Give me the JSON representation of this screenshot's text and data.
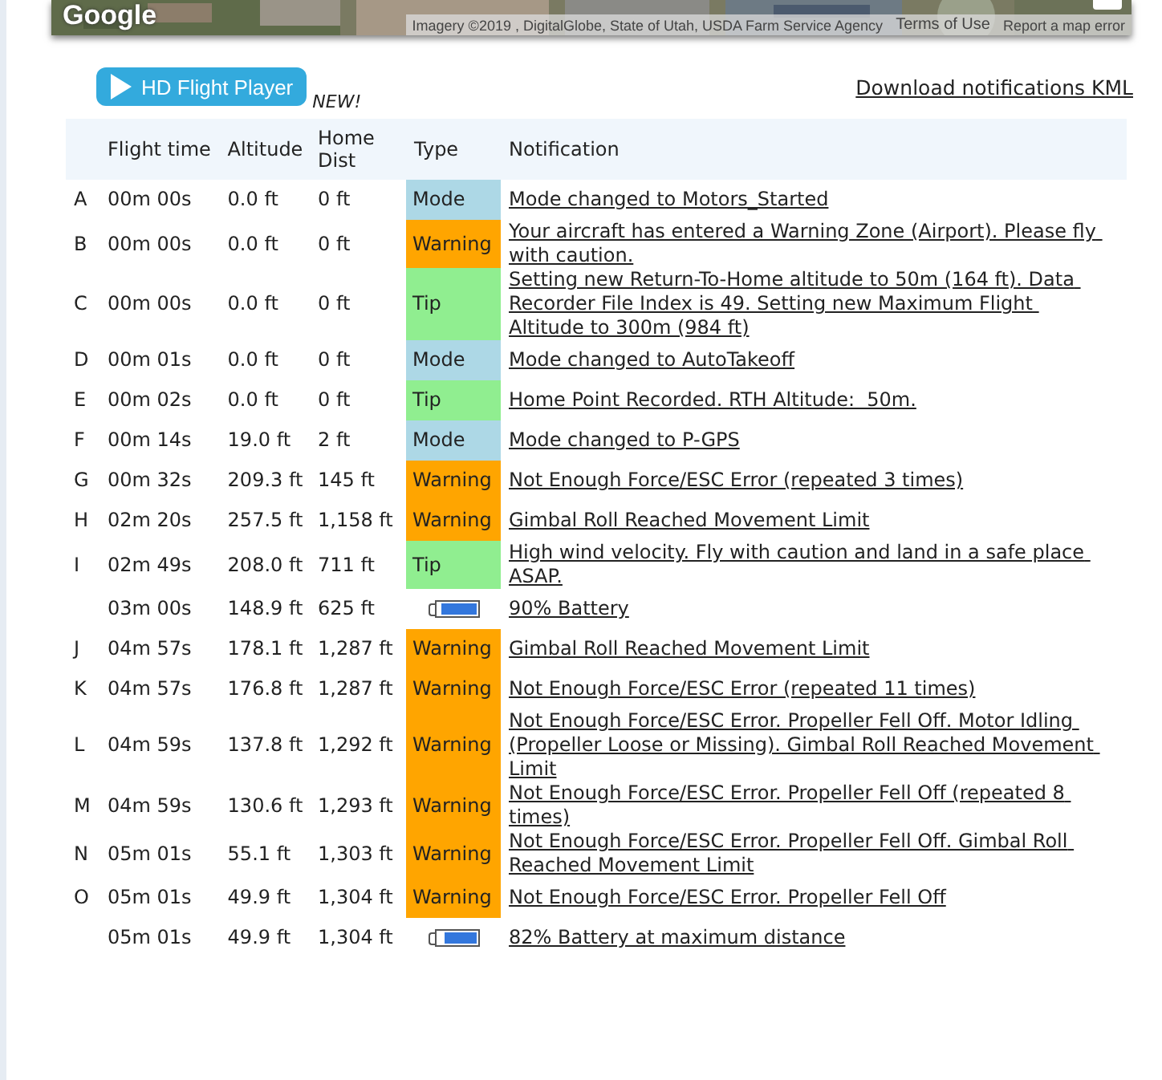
{
  "map": {
    "logo": "Google",
    "attribution": "Imagery ©2019 , DigitalGlobe, State of Utah, USDA Farm Service Agency",
    "terms": "Terms of Use",
    "report": "Report a map error"
  },
  "player_button": "HD Flight Player",
  "new_badge": "NEW!",
  "download_link": "Download notifications KML",
  "table": {
    "columns": [
      "Flight time",
      "Altitude",
      "Home Dist",
      "Type",
      "Notification"
    ],
    "rows": [
      {
        "kind": "event",
        "marker": "A",
        "time": "00m 00s",
        "altitude": "0.0 ft",
        "home_dist": "0 ft",
        "type": "Mode",
        "color": "#add8e6",
        "notification": "Mode changed to Motors_Started"
      },
      {
        "kind": "event",
        "marker": "B",
        "time": "00m 00s",
        "altitude": "0.0 ft",
        "home_dist": "0 ft",
        "type": "Warning",
        "color": "#ffa500",
        "notification": "Your aircraft has entered a Warning Zone (Airport). Please fly with caution."
      },
      {
        "kind": "event",
        "marker": "C",
        "time": "00m 00s",
        "altitude": "0.0 ft",
        "home_dist": "0 ft",
        "type": "Tip",
        "color": "#90ee90",
        "notification": "Setting new Return-To-Home altitude to 50m (164 ft). Data Recorder File Index is 49. Setting new Maximum Flight Altitude to 300m (984 ft)"
      },
      {
        "kind": "event",
        "marker": "D",
        "time": "00m 01s",
        "altitude": "0.0 ft",
        "home_dist": "0 ft",
        "type": "Mode",
        "color": "#add8e6",
        "notification": "Mode changed to AutoTakeoff"
      },
      {
        "kind": "event",
        "marker": "E",
        "time": "00m 02s",
        "altitude": "0.0 ft",
        "home_dist": "0 ft",
        "type": "Tip",
        "color": "#90ee90",
        "notification": "Home Point Recorded. RTH Altitude:  50m."
      },
      {
        "kind": "event",
        "marker": "F",
        "time": "00m 14s",
        "altitude": "19.0 ft",
        "home_dist": "2 ft",
        "type": "Mode",
        "color": "#add8e6",
        "notification": "Mode changed to P-GPS"
      },
      {
        "kind": "event",
        "marker": "G",
        "time": "00m 32s",
        "altitude": "209.3 ft",
        "home_dist": "145 ft",
        "type": "Warning",
        "color": "#ffa500",
        "notification": "Not Enough Force/ESC Error (repeated 3 times)"
      },
      {
        "kind": "event",
        "marker": "H",
        "time": "02m 20s",
        "altitude": "257.5 ft",
        "home_dist": "1,158 ft",
        "type": "Warning",
        "color": "#ffa500",
        "notification": "Gimbal Roll Reached Movement Limit"
      },
      {
        "kind": "event",
        "marker": "I",
        "time": "02m 49s",
        "altitude": "208.0 ft",
        "home_dist": "711 ft",
        "type": "Tip",
        "color": "#90ee90",
        "notification": "High wind velocity. Fly with caution and land in a safe place ASAP."
      },
      {
        "kind": "battery",
        "time": "03m 00s",
        "altitude": "148.9 ft",
        "home_dist": "625 ft",
        "level": 0.9,
        "notification": "90% Battery"
      },
      {
        "kind": "event",
        "marker": "J",
        "time": "04m 57s",
        "altitude": "178.1 ft",
        "home_dist": "1,287 ft",
        "type": "Warning",
        "color": "#ffa500",
        "notification": "Gimbal Roll Reached Movement Limit"
      },
      {
        "kind": "event",
        "marker": "K",
        "time": "04m 57s",
        "altitude": "176.8 ft",
        "home_dist": "1,287 ft",
        "type": "Warning",
        "color": "#ffa500",
        "notification": "Not Enough Force/ESC Error (repeated 11 times)"
      },
      {
        "kind": "event",
        "marker": "L",
        "time": "04m 59s",
        "altitude": "137.8 ft",
        "home_dist": "1,292 ft",
        "type": "Warning",
        "color": "#ffa500",
        "notification": "Not Enough Force/ESC Error. Propeller Fell Off. Motor Idling (Propeller Loose or Missing). Gimbal Roll Reached Movement Limit"
      },
      {
        "kind": "event",
        "marker": "M",
        "time": "04m 59s",
        "altitude": "130.6 ft",
        "home_dist": "1,293 ft",
        "type": "Warning",
        "color": "#ffa500",
        "notification": "Not Enough Force/ESC Error. Propeller Fell Off (repeated 8 times)"
      },
      {
        "kind": "event",
        "marker": "N",
        "time": "05m 01s",
        "altitude": "55.1 ft",
        "home_dist": "1,303 ft",
        "type": "Warning",
        "color": "#ffa500",
        "notification": "Not Enough Force/ESC Error. Propeller Fell Off. Gimbal Roll Reached Movement Limit"
      },
      {
        "kind": "event",
        "marker": "O",
        "time": "05m 01s",
        "altitude": "49.9 ft",
        "home_dist": "1,304 ft",
        "type": "Warning",
        "color": "#ffa500",
        "notification": "Not Enough Force/ESC Error. Propeller Fell Off"
      },
      {
        "kind": "battery",
        "time": "05m 01s",
        "altitude": "49.9 ft",
        "home_dist": "1,304 ft",
        "level": 0.82,
        "notification": "82% Battery at maximum distance"
      }
    ]
  }
}
